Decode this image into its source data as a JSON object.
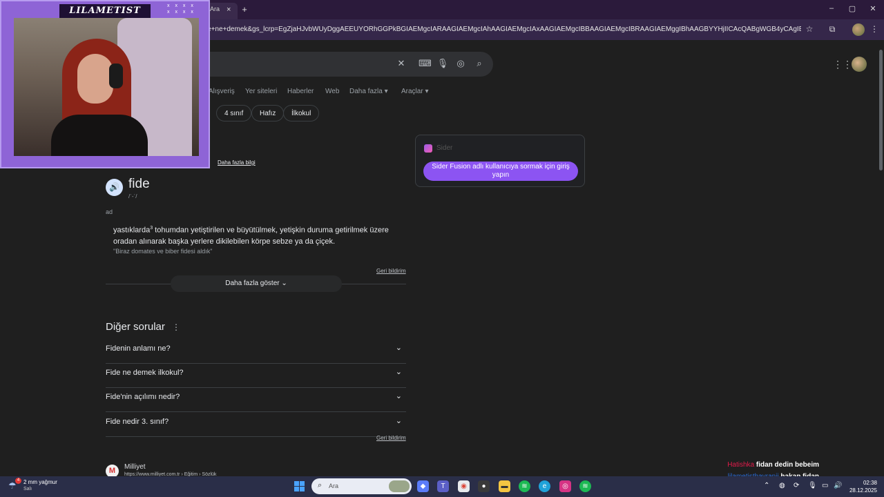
{
  "browser": {
    "tab_title": "Ara",
    "tab_close": "×",
    "new_tab": "+",
    "url": "e+ne+demek&gs_lcrp=EgZjaHJvbWUyDggAEEUYORhGGPkBGIAEMgcIARAAGIAEMgcIAhAAGIAEMgcIAxAAGIAEMgcIBBAAGIAEMgcIBRAAGIAEMggIBhAAGBYYHjIICAcQABgWGB4yCAgIEAAYFhgeMggICRAAG...",
    "window_controls": {
      "minimize": "–",
      "maximize": "▢",
      "close": "✕"
    }
  },
  "search": {
    "nav_tabs": [
      "Alışveriş",
      "Yer siteleri",
      "Haberler",
      "Web",
      "Daha fazla",
      "Araçlar"
    ],
    "chips": [
      "4 sınıf",
      "Hafız",
      "İlkokul"
    ]
  },
  "dictionary": {
    "more_info": "Daha fazla bilgi",
    "word": "fide",
    "phonetic": "/ˈ-ˈ/",
    "part_of_speech": "ad",
    "definition_a": "yastıklarda",
    "definition_sup": "3",
    "definition_b": " tohumdan yetiştirilen ve büyütülmek, yetişkin duruma getirilmek üzere oradan alınarak başka yerlere dikilebilen körpe sebze ya da çiçek.",
    "example": "\"Biraz domates ve biber fidesi aldık\"",
    "feedback": "Geri bildirim",
    "show_more": "Daha fazla göster"
  },
  "paa": {
    "title": "Diğer sorular",
    "questions": [
      "Fidenin anlamı ne?",
      "Fide ne demek ilkokul?",
      "Fide'nin açılımı nedir?",
      "Fide nedir 3. sınıf?"
    ],
    "feedback": "Geri bildirim"
  },
  "result": {
    "site_name": "Milliyet",
    "site_url": "https://www.milliyet.com.tr › Eğitim › Sözlük"
  },
  "sider": {
    "name": "Sider",
    "button": "Sider Fusion adlı kullanıcıya sormak için giriş yapın"
  },
  "stream": {
    "channel_name": "LILAMETIST",
    "chat": [
      {
        "user": "Hatishka",
        "message": "fidan dedin bebeim"
      },
      {
        "user": "lilametisthayranii",
        "message": "hakan fidan"
      }
    ]
  },
  "taskbar": {
    "weather_count": "4",
    "weather_text": "2 mm yağmur",
    "weather_sub": "Salı",
    "search_placeholder": "Ara",
    "time": "02:38",
    "date": "28.12.2025"
  },
  "colors": {
    "accent": "#8c54f2",
    "page_bg": "#1f1f1f",
    "chrome_bg": "#2b1a3b"
  }
}
